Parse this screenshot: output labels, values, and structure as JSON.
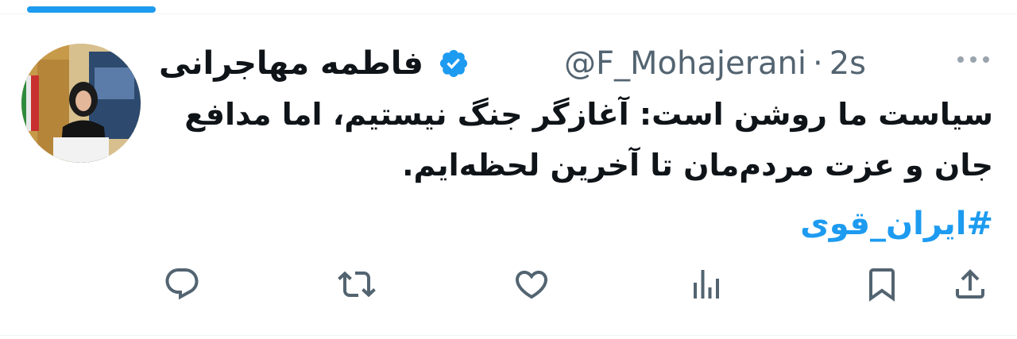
{
  "author": {
    "display_name": "فاطمه مهاجرانی",
    "handle": "@F_Mohajerani",
    "separator": "·",
    "time": "2s",
    "verified": true
  },
  "tweet": {
    "text": "سیاست ما روشن است: آغازگر جنگ نیستیم، اما مدافع جان و عزت مردم‌مان تا آخرین لحظه‌ایم.",
    "hashtag": "#ایران_قوی"
  },
  "colors": {
    "accent": "#1d9bf0",
    "text_primary": "#0f1419",
    "text_secondary": "#536471"
  },
  "icons": {
    "more": "more-icon",
    "reply": "reply-icon",
    "retweet": "retweet-icon",
    "like": "like-icon",
    "views": "views-icon",
    "bookmark": "bookmark-icon",
    "share": "share-icon"
  }
}
